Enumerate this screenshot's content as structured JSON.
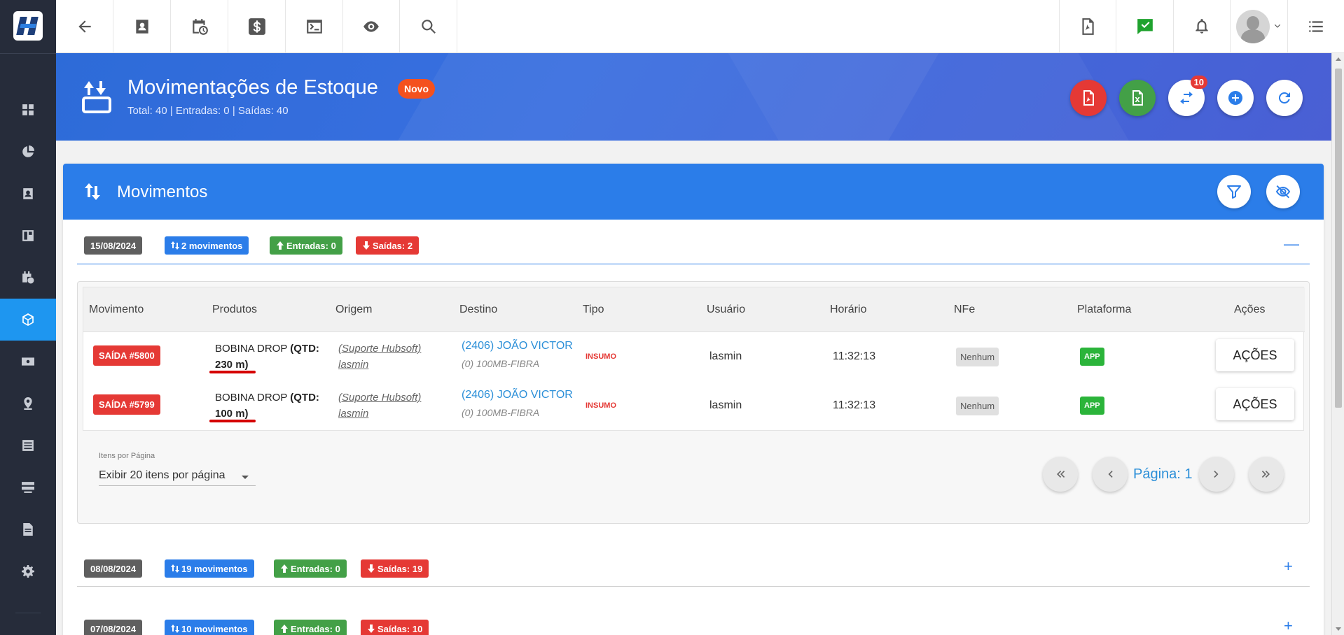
{
  "banner": {
    "title": "Movimentações de Estoque",
    "badge": "Novo",
    "subtitle": "Total: 40 | Entradas: 0 | Saídas: 40",
    "notification_count": "10"
  },
  "card": {
    "title": "Movimentos"
  },
  "groups": [
    {
      "date": "15/08/2024",
      "movements": "2 movimentos",
      "entradas": "Entradas: 0",
      "saidas": "Saídas: 2",
      "toggle": "—"
    },
    {
      "date": "08/08/2024",
      "movements": "19 movimentos",
      "entradas": "Entradas: 0",
      "saidas": "Saídas: 19",
      "toggle": "+"
    },
    {
      "date": "07/08/2024",
      "movements": "10 movimentos",
      "entradas": "Entradas: 0",
      "saidas": "Saídas: 10",
      "toggle": "+"
    }
  ],
  "table": {
    "headers": [
      "Movimento",
      "Produtos",
      "Origem",
      "Destino",
      "Tipo",
      "Usuário",
      "Horário",
      "NFe",
      "Plataforma",
      "Ações"
    ],
    "rows": [
      {
        "movimento": "SAÍDA #5800",
        "produto_name": "BOBINA DROP ",
        "produto_qtd": "(QTD: 230 m)",
        "origem_line1": "(Suporte Hubsoft)",
        "origem_line2": "lasmin",
        "destino": "(2406) JOÃO VICTOR",
        "destino_sub": "(0) 100MB-FIBRA",
        "tipo": "INSUMO",
        "usuario": "lasmin",
        "horario": "11:32:13",
        "nfe": "Nenhum",
        "plataforma": "APP",
        "acoes": "AÇÕES"
      },
      {
        "movimento": "SAÍDA #5799",
        "produto_name": "BOBINA DROP ",
        "produto_qtd": "(QTD: 100 m)",
        "origem_line1": "(Suporte Hubsoft)",
        "origem_line2": "lasmin",
        "destino": "(2406) JOÃO VICTOR",
        "destino_sub": "(0) 100MB-FIBRA",
        "tipo": "INSUMO",
        "usuario": "lasmin",
        "horario": "11:32:13",
        "nfe": "Nenhum",
        "plataforma": "APP",
        "acoes": "AÇÕES"
      }
    ]
  },
  "pagination": {
    "items_label": "Itens por Página",
    "items_value": "Exibir 20 itens por página",
    "page_label": "Página: 1"
  },
  "colors": {
    "accent_blue": "#2b7de9",
    "sidebar_bg": "#262c3a",
    "sidebar_active": "#1e96f0",
    "danger": "#e53935",
    "success": "#43a047"
  },
  "icons": {
    "sidebar": [
      "dashboard-icon",
      "pie-chart-icon",
      "contact-card-icon",
      "board-icon",
      "calendar-clock-icon",
      "box-icon",
      "money-icon",
      "map-pin-icon",
      "list-icon",
      "server-icon",
      "document-icon",
      "gear-icon"
    ],
    "topbar": [
      "back-arrow-icon",
      "contact-icon",
      "calendar-clock-icon",
      "dollar-icon",
      "terminal-icon",
      "eye-icon",
      "search-icon",
      "pdf-icon",
      "chat-check-icon",
      "bell-icon",
      "avatar",
      "menu-list-icon"
    ]
  }
}
